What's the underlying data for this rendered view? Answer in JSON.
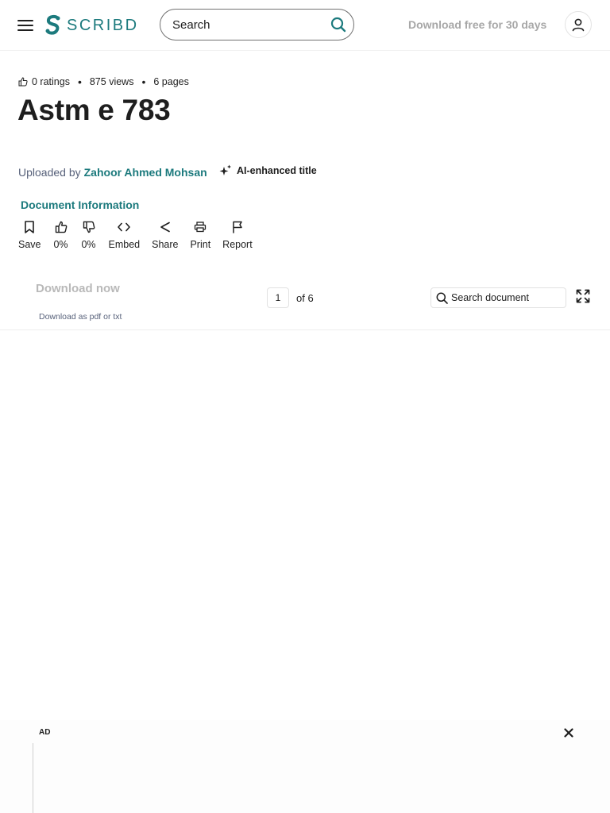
{
  "header": {
    "logo_text": "SCRIBD",
    "search_placeholder": "Search",
    "trial_link": "Download free for 30 days"
  },
  "document": {
    "stats": {
      "ratings": "0 ratings",
      "views": "875 views",
      "pages": "6 pages"
    },
    "title": "Astm e 783",
    "uploaded_by_label": "Uploaded by",
    "author": "Zahoor Ahmed Mohsan",
    "ai_badge": "AI-enhanced title",
    "info_link": "Document Information"
  },
  "actions": [
    {
      "label": "Save",
      "icon": "bookmark-icon"
    },
    {
      "label": "0%",
      "icon": "thumbs-up-icon"
    },
    {
      "label": "0%",
      "icon": "thumbs-down-icon"
    },
    {
      "label": "Embed",
      "icon": "code-icon"
    },
    {
      "label": "Share",
      "icon": "share-icon"
    },
    {
      "label": "Print",
      "icon": "printer-icon"
    },
    {
      "label": "Report",
      "icon": "flag-icon"
    }
  ],
  "toolbar": {
    "download_label": "Download now",
    "download_sub": "Download as pdf or txt",
    "current_page": "1",
    "page_of": "of 6",
    "search_placeholder": "Search document"
  },
  "ad": {
    "label": "AD"
  },
  "colors": {
    "brand": "#1c7a7d",
    "text": "#1e1e1e",
    "muted": "#57617a",
    "disabled": "#b9b9b9"
  }
}
